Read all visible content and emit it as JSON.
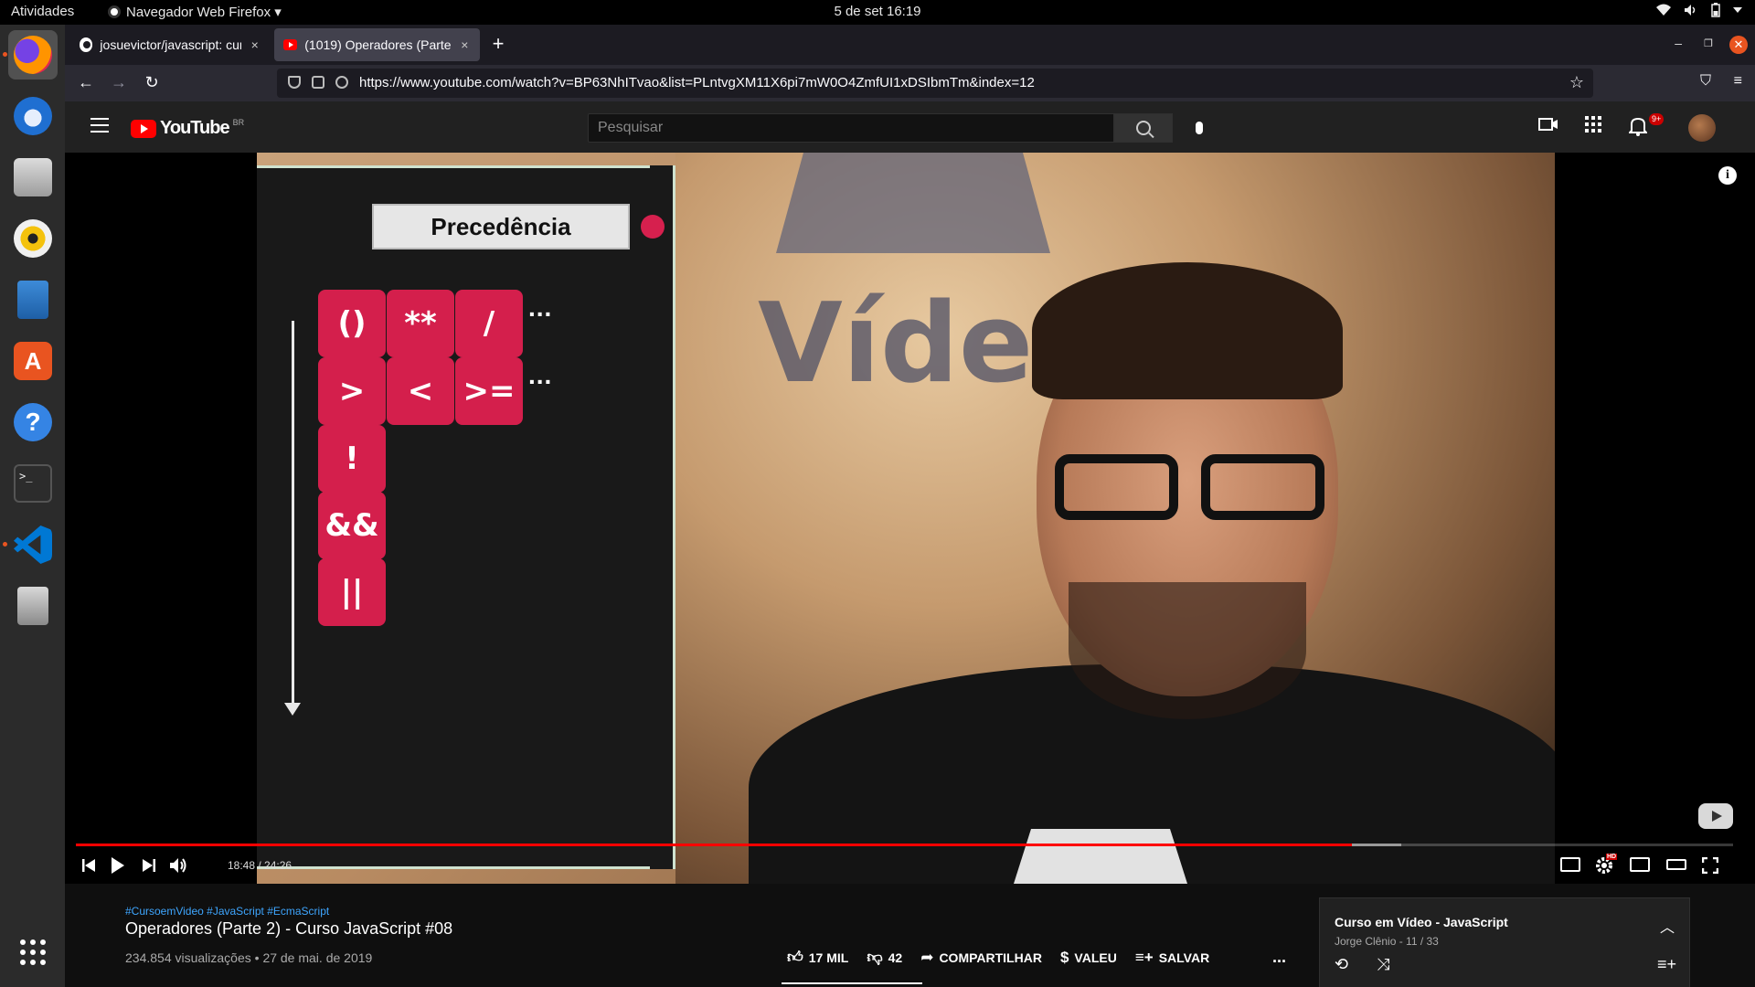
{
  "topbar": {
    "activities": "Atividades",
    "app_name": "Navegador Web Firefox ▾",
    "clock": "5 de set  16:19"
  },
  "dock": {
    "items": [
      "firefox",
      "thunderbird",
      "files",
      "rhythmbox",
      "writer",
      "software-center",
      "help",
      "terminal",
      "vscode",
      "disk",
      "show-apps"
    ]
  },
  "browser": {
    "tabs": [
      {
        "title": "josuevictor/javascript: cur",
        "close": "×"
      },
      {
        "title": "(1019) Operadores (Parte",
        "close": "×"
      }
    ],
    "new_tab": "+",
    "url": "https://www.youtube.com/watch?v=BP63NhITvao&list=PLntvgXM11X6pi7mW0O4ZmfUI1xDSIbmTm&index=12"
  },
  "youtube": {
    "logo_text": "YouTube",
    "region": "BR",
    "search_placeholder": "Pesquisar",
    "notification_badge": "9+"
  },
  "slide": {
    "title": "Precedência",
    "operators_row1": [
      "()",
      "**",
      "/"
    ],
    "operators_row2": [
      ">",
      "<",
      ">="
    ],
    "operator_not": "!",
    "operator_and": "&&",
    "operator_or": "||",
    "ellipsis": "..."
  },
  "scene": {
    "sign_text": "Vídeo"
  },
  "player": {
    "time": "18:48 / 24:26",
    "progress": 0.77,
    "buffered": 0.8,
    "hd_badge": "HD"
  },
  "video": {
    "hashtags": "#CursoemVideo #JavaScript #EcmaScript",
    "title": "Operadores (Parte 2) - Curso JavaScript #08",
    "meta": "234.854 visualizações • 27 de mai. de 2019",
    "likes": "17 MIL",
    "dislikes": "42",
    "share": "COMPARTILHAR",
    "thanks": "VALEU",
    "save": "SALVAR",
    "more": "..."
  },
  "playlist": {
    "title": "Curso em Vídeo - JavaScript",
    "subtitle": "Jorge Clênio - 11 / 33"
  },
  "colors": {
    "accent_red": "#ff0000",
    "operator_red": "#d41f4c",
    "link_blue": "#3ea6ff"
  }
}
